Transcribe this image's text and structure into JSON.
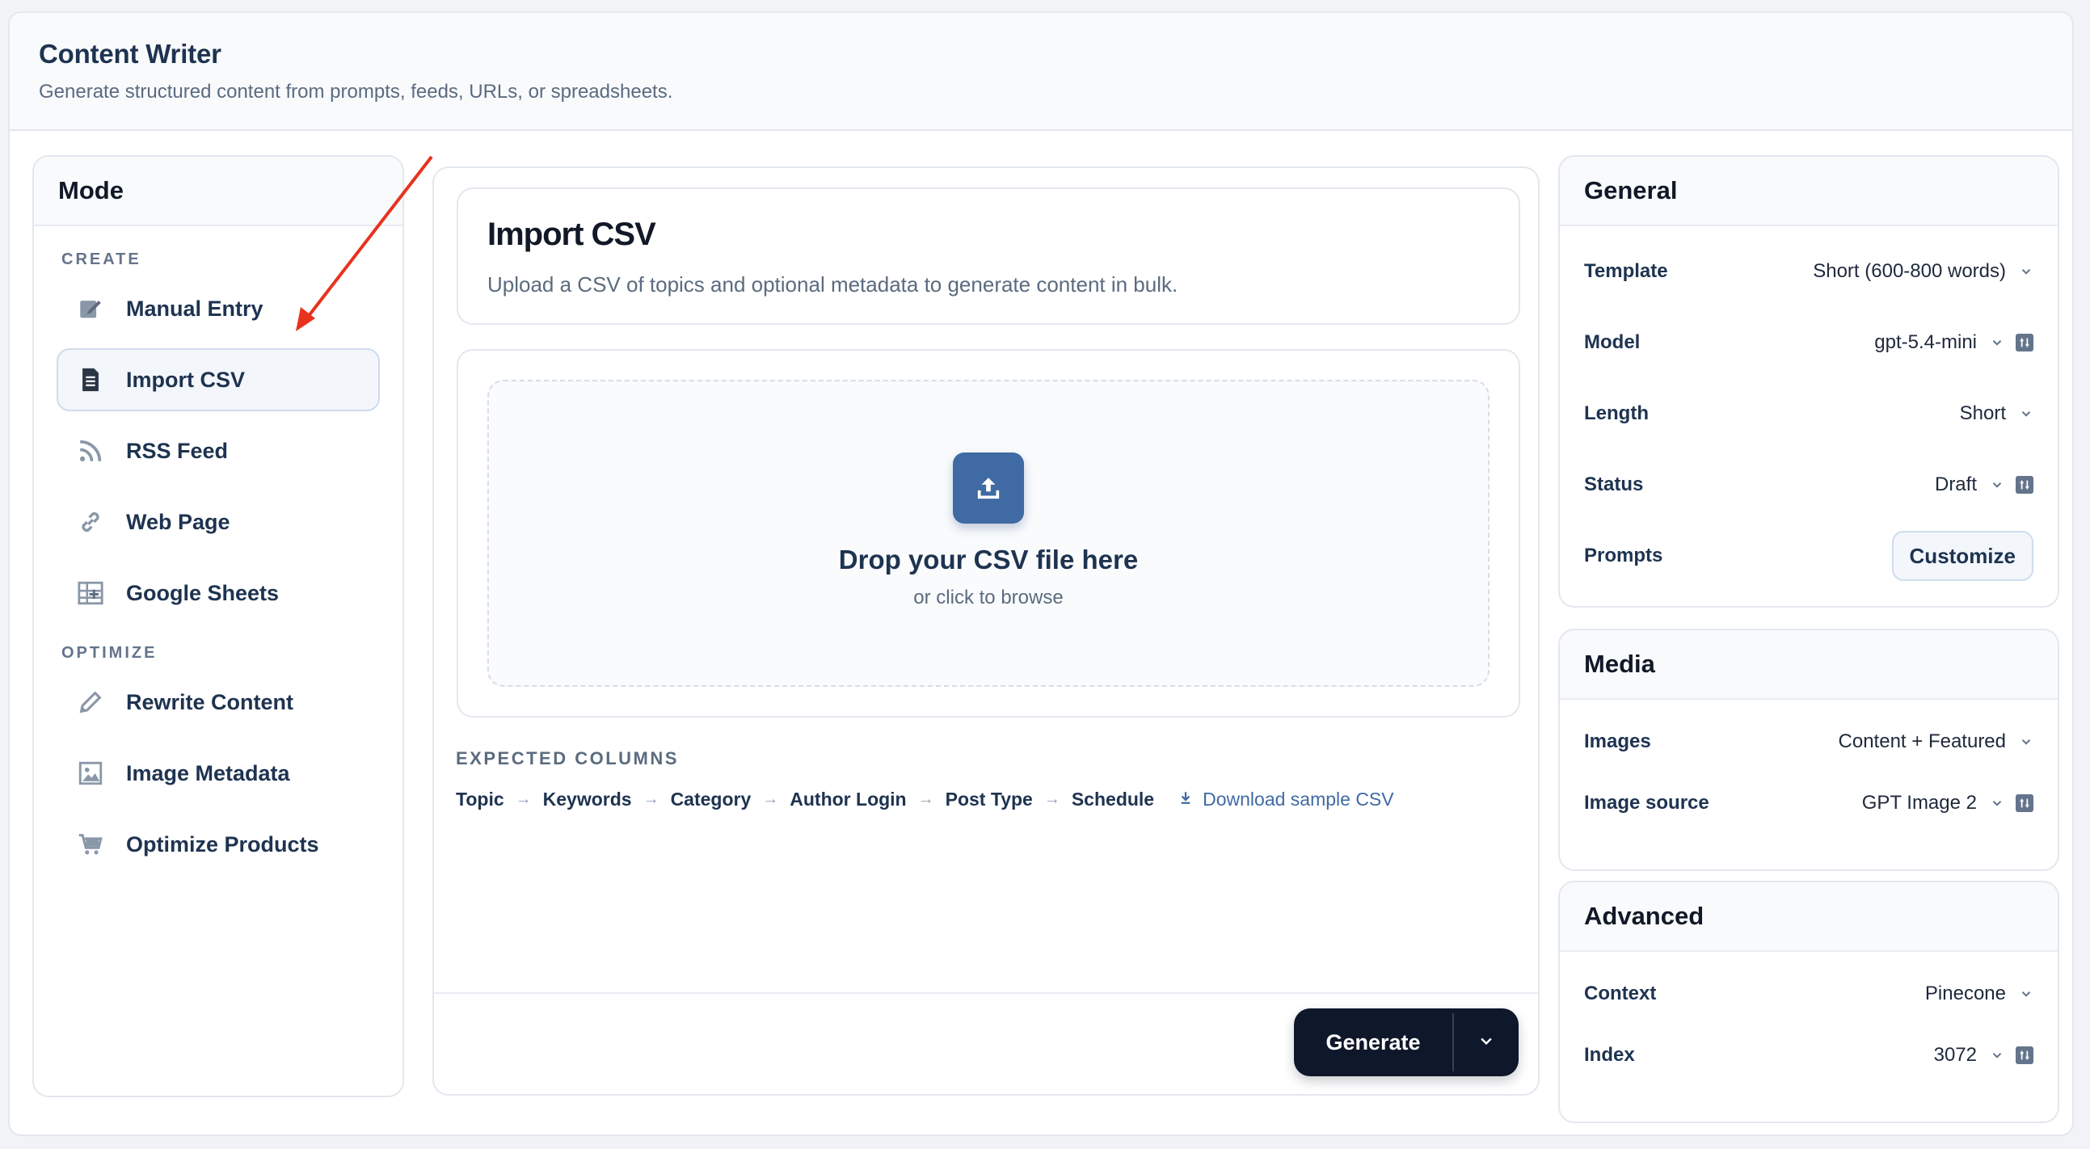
{
  "header": {
    "title": "Content Writer",
    "subtitle": "Generate structured content from prompts, feeds, URLs, or spreadsheets."
  },
  "mode_panel": {
    "title": "Mode",
    "create_label": "CREATE",
    "create_items": [
      {
        "label": "Manual Entry",
        "icon": "edit-icon"
      },
      {
        "label": "Import CSV",
        "icon": "document-icon",
        "active": true
      },
      {
        "label": "RSS Feed",
        "icon": "rss-icon"
      },
      {
        "label": "Web Page",
        "icon": "link-icon"
      },
      {
        "label": "Google Sheets",
        "icon": "spreadsheet-icon"
      }
    ],
    "optimize_label": "OPTIMIZE",
    "optimize_items": [
      {
        "label": "Rewrite Content",
        "icon": "pencil-icon"
      },
      {
        "label": "Image Metadata",
        "icon": "image-icon"
      },
      {
        "label": "Optimize Products",
        "icon": "cart-icon"
      }
    ]
  },
  "main": {
    "title": "Import CSV",
    "description": "Upload a CSV of topics and optional metadata to generate content in bulk.",
    "dropzone": {
      "title": "Drop your CSV file here",
      "subtitle": "or click to browse"
    },
    "expected_columns_label": "EXPECTED COLUMNS",
    "columns": [
      "Topic",
      "Keywords",
      "Category",
      "Author Login",
      "Post Type",
      "Schedule"
    ],
    "download_label": "Download sample CSV",
    "generate_label": "Generate"
  },
  "general": {
    "title": "General",
    "template_label": "Template",
    "template_value": "Short (600-800 words)",
    "model_label": "Model",
    "model_value": "gpt-5.4-mini",
    "length_label": "Length",
    "length_value": "Short",
    "status_label": "Status",
    "status_value": "Draft",
    "prompts_label": "Prompts",
    "prompts_button": "Customize"
  },
  "media": {
    "title": "Media",
    "images_label": "Images",
    "images_value": "Content + Featured",
    "source_label": "Image source",
    "source_value": "GPT Image 2"
  },
  "advanced": {
    "title": "Advanced",
    "context_label": "Context",
    "context_value": "Pinecone",
    "index_label": "Index",
    "index_value": "3072"
  },
  "colors": {
    "accent": "#3f6aa3",
    "primary_dark": "#0f172a",
    "annotation_arrow": "#e8321e"
  }
}
